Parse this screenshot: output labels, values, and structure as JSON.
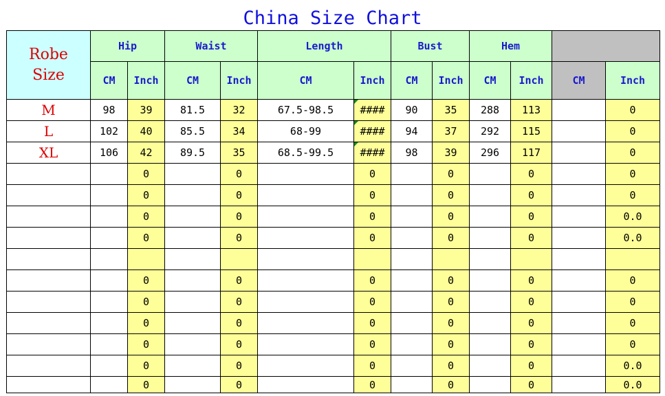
{
  "title": "China Size Chart",
  "header": {
    "robe": "Robe",
    "size": "Size",
    "groups": [
      "Hip",
      "Waist",
      "Length",
      "Bust",
      "Hem",
      ""
    ],
    "units": [
      "CM",
      "Inch",
      "CM",
      "Inch",
      "CM",
      "Inch",
      "CM",
      "Inch",
      "CM",
      "Inch",
      "CM",
      "Inch"
    ]
  },
  "rows": [
    {
      "size": "M",
      "cells": [
        "98",
        "39",
        "81.5",
        "32",
        "67.5-98.5",
        "####",
        "90",
        "35",
        "288",
        "113",
        "",
        "0"
      ]
    },
    {
      "size": "L",
      "cells": [
        "102",
        "40",
        "85.5",
        "34",
        "68-99",
        "####",
        "94",
        "37",
        "292",
        "115",
        "",
        "0"
      ]
    },
    {
      "size": "XL",
      "cells": [
        "106",
        "42",
        "89.5",
        "35",
        "68.5-99.5",
        "####",
        "98",
        "39",
        "296",
        "117",
        "",
        "0"
      ]
    },
    {
      "size": "",
      "cells": [
        "",
        "0",
        "",
        "0",
        "",
        "0",
        "",
        "0",
        "",
        "0",
        "",
        "0"
      ]
    },
    {
      "size": "",
      "cells": [
        "",
        "0",
        "",
        "0",
        "",
        "0",
        "",
        "0",
        "",
        "0",
        "",
        "0"
      ]
    },
    {
      "size": "",
      "cells": [
        "",
        "0",
        "",
        "0",
        "",
        "0",
        "",
        "0",
        "",
        "0",
        "",
        "0.0"
      ]
    },
    {
      "size": "",
      "cells": [
        "",
        "0",
        "",
        "0",
        "",
        "0",
        "",
        "0",
        "",
        "0",
        "",
        "0.0"
      ]
    },
    {
      "size": "",
      "cells": [
        "",
        "",
        "",
        "",
        "",
        "",
        "",
        "",
        "",
        "",
        "",
        ""
      ]
    },
    {
      "size": "",
      "cells": [
        "",
        "0",
        "",
        "0",
        "",
        "0",
        "",
        "0",
        "",
        "0",
        "",
        "0"
      ]
    },
    {
      "size": "",
      "cells": [
        "",
        "0",
        "",
        "0",
        "",
        "0",
        "",
        "0",
        "",
        "0",
        "",
        "0"
      ]
    },
    {
      "size": "",
      "cells": [
        "",
        "0",
        "",
        "0",
        "",
        "0",
        "",
        "0",
        "",
        "0",
        "",
        "0"
      ]
    },
    {
      "size": "",
      "cells": [
        "",
        "0",
        "",
        "0",
        "",
        "0",
        "",
        "0",
        "",
        "0",
        "",
        "0"
      ]
    },
    {
      "size": "",
      "cells": [
        "",
        "0",
        "",
        "0",
        "",
        "0",
        "",
        "0",
        "",
        "0",
        "",
        "0.0"
      ]
    },
    {
      "size": "",
      "cells": [
        "",
        "0",
        "",
        "0",
        "",
        "0",
        "",
        "0",
        "",
        "0",
        "",
        "0.0"
      ]
    }
  ],
  "colors": {
    "header_green": "#ccffcc",
    "header_cyan": "#ccffff",
    "header_gray": "#c0c0c0",
    "inch_yellow": "#ffff99",
    "title_blue": "#1010dd",
    "size_red": "#dd0000"
  }
}
